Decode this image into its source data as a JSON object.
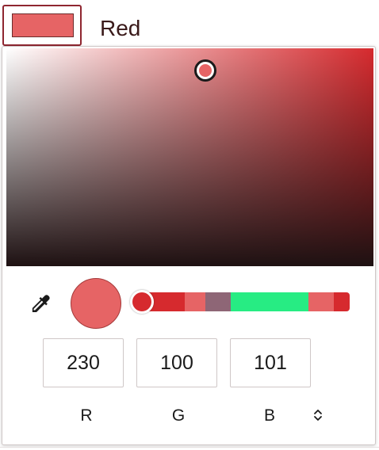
{
  "swatch": {
    "color": "#e66465",
    "name": "Red"
  },
  "picker": {
    "hue_color": "#d62a2e",
    "handle_color": "#e66465"
  },
  "preview": {
    "color": "#e66465"
  },
  "hue_slider": {
    "thumb_color": "#d62a2e",
    "segments": [
      {
        "color": "#d62a2e"
      },
      {
        "color": "#e66465"
      },
      {
        "color": "#8e6676"
      },
      {
        "color": "#27ec83"
      },
      {
        "color": "#e66465"
      },
      {
        "color": "#d62a2e"
      }
    ]
  },
  "channels": [
    {
      "label": "R",
      "value": "230"
    },
    {
      "label": "G",
      "value": "100"
    },
    {
      "label": "B",
      "value": "101"
    }
  ],
  "icons": {
    "eyedropper": "eyedropper-icon",
    "mode_toggle": "chevron-up-down-icon"
  }
}
